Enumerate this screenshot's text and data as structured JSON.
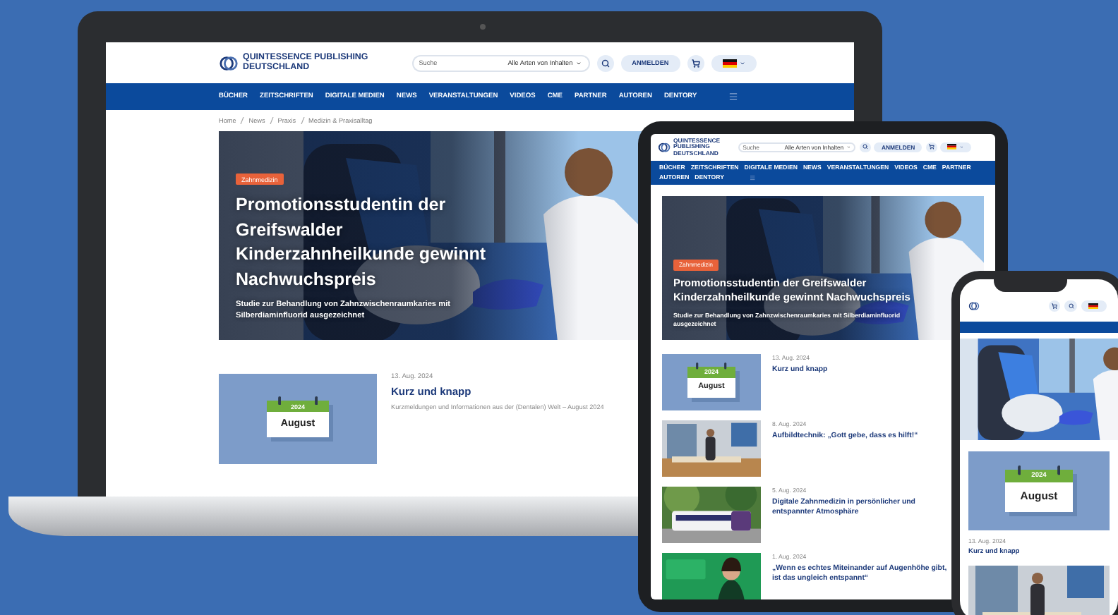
{
  "laptop": {
    "header": {
      "logo_line_1": "QUINTESSENCE PUBLISHING",
      "logo_line_2": "DEUTSCHLAND",
      "search": {
        "placeholder": "Suche"
      },
      "content_filter": "Alle Arten von Inhalten",
      "login_button": "ANMELDEN"
    },
    "nav": [
      "BÜCHER",
      "ZEITSCHRIFTEN",
      "DIGITALE MEDIEN",
      "NEWS",
      "VERANSTALTUNGEN",
      "VIDEOS",
      "CME",
      "PARTNER",
      "AUTOREN",
      "DENTORY"
    ],
    "breadcrumb": [
      "Home",
      "News",
      "Praxis",
      "Medizin & Praxisalltag"
    ],
    "hero": {
      "tag": "Zahnmedizin",
      "title": "Promotionsstudentin der Greifswalder Kinderzahnheilkunde gewinnt Nachwuchspreis",
      "subtitle": "Studie zur Behandlung von Zahnzwischenraumkaries mit Silberdiaminfluorid ausgezeichnet"
    },
    "articles": [
      {
        "kind": "calendar",
        "year": "2024",
        "month": "August",
        "date": "13. Aug. 2024",
        "title": "Kurz und knapp",
        "subtitle": "Kurzmeldungen und Informationen aus der (Dentalen) Welt – August 2024"
      }
    ]
  },
  "tablet": {
    "header": {
      "logo_line_1": "QUINTESSENCE PUBLISHING",
      "logo_line_2": "DEUTSCHLAND",
      "search": {
        "placeholder": "Suche"
      },
      "content_filter": "Alle Arten von Inhalten",
      "login_button": "ANMELDEN"
    },
    "nav": [
      "BÜCHER",
      "ZEITSCHRIFTEN",
      "DIGITALE MEDIEN",
      "NEWS",
      "VERANSTALTUNGEN",
      "VIDEOS",
      "CME",
      "PARTNER",
      "AUTOREN",
      "DENTORY"
    ],
    "hero": {
      "tag": "Zahnmedizin",
      "title": "Promotionsstudentin der Greifswalder Kinderzahnheilkunde gewinnt Nachwuchspreis",
      "subtitle": "Studie zur Behandlung von Zahnzwischenraumkaries mit Silberdiaminfluorid ausgezeichnet"
    },
    "articles": [
      {
        "kind": "calendar",
        "year": "2024",
        "month": "August",
        "date": "13. Aug. 2024",
        "title": "Kurz und knapp"
      },
      {
        "kind": "office",
        "date": "8. Aug. 2024",
        "title": "Aufbildtechnik: „Gott gebe, dass es hilft!“"
      },
      {
        "kind": "bus",
        "date": "5. Aug. 2024",
        "title": "Digitale Zahnmedizin in persönlicher und entspannter Atmosphäre"
      },
      {
        "kind": "portrait",
        "date": "1. Aug. 2024",
        "title": "„Wenn es echtes Miteinander auf Augenhöhe gibt, ist das ungleich entspannt“"
      }
    ]
  },
  "phone": {
    "articles": [
      {
        "kind": "calendar",
        "year": "2024",
        "month": "August",
        "date": "13. Aug. 2024",
        "title": "Kurz und knapp"
      },
      {
        "kind": "office"
      }
    ]
  }
}
